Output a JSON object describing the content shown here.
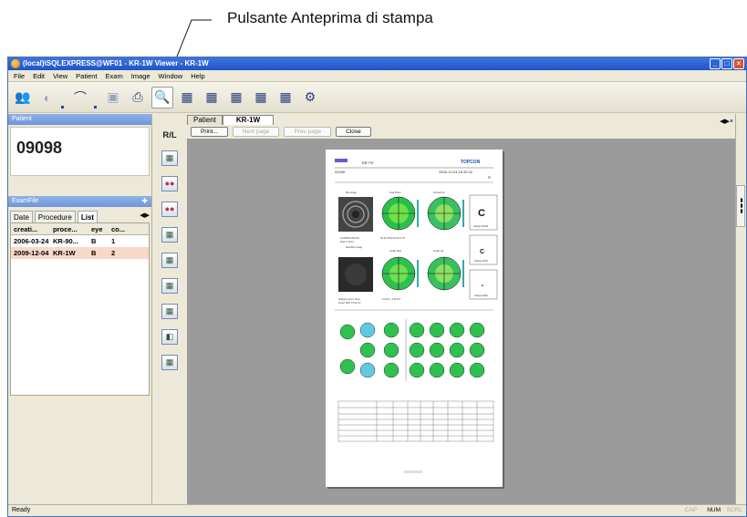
{
  "callout": {
    "label": "Pulsante Anteprima di stampa"
  },
  "window": {
    "title": "(local)\\SQLEXPRESS@WF01 - KR-1W Viewer - KR-1W",
    "buttons": [
      "minimize",
      "maximize",
      "close"
    ]
  },
  "menu": [
    "File",
    "Edit",
    "View",
    "Patient",
    "Exam",
    "Image",
    "Window",
    "Help"
  ],
  "toolbar": {
    "icons": [
      "patient-icon",
      "back-icon",
      "exam-icon",
      "save-icon",
      "print-icon",
      "print-preview-icon",
      "analysis-icon-1",
      "analysis-icon-2",
      "analysis-icon-3",
      "analysis-icon-4",
      "analysis-icon-5",
      "settings-icon"
    ]
  },
  "left": {
    "pane_title": "Patient",
    "patient_id": "09098",
    "exam_list_title": "ExamFile",
    "tabs": [
      "Date",
      "Procedure",
      "List"
    ],
    "columns": [
      "creati...",
      "proce...",
      "eye",
      "co..."
    ],
    "rows": [
      [
        "2006-03-24",
        "KR-90...",
        "B",
        "1"
      ],
      [
        "2009-12-04",
        "KR-1W",
        "B",
        "2"
      ]
    ]
  },
  "strip": {
    "rl_label": "R/L"
  },
  "doc": {
    "tabs": [
      "Patient",
      "KR-1W"
    ],
    "buttons": [
      "Print...",
      "Next page",
      "Prev page",
      "Close"
    ]
  },
  "report": {
    "logo_left": "KR-1W",
    "logo_right": "TOPCON",
    "patient": "09098",
    "datetime": "2009-12-04 18:35:42",
    "eye": "R",
    "section_labels": [
      "Mire image",
      "Axial Power",
      "Corneal Cyl",
      "Retroillum image",
      "Ocular Total",
      "Ocular Cyl"
    ],
    "optotype_labels": [
      "OptAge 20/100",
      "OptAge 20/40",
      "OptAge 20/20"
    ],
    "c_letters": [
      "C",
      "C",
      "c"
    ],
    "notes": [
      "12/4/2009 18:50:46",
      "Pupil: 4.79mm",
      "Analysis Center: Pupil",
      "Center Shift: 0.791 mm"
    ],
    "sphcyl": "S 0.00 C -1.25 A77"
  },
  "status": {
    "left": "Ready",
    "indicators": [
      "CAP",
      "NUM",
      "SCRL"
    ]
  }
}
